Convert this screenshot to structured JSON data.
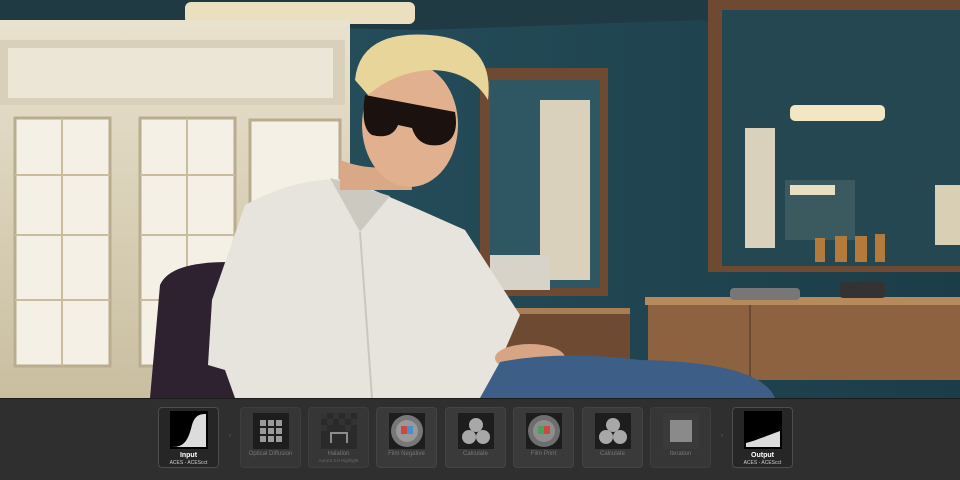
{
  "pipeline": {
    "nodes": [
      {
        "title": "Input",
        "subtitle": "ACES - ACEScct",
        "icon": "s-curve-icon"
      },
      {
        "title": "Optical Diffusion",
        "subtitle": "",
        "icon": "grid-icon"
      },
      {
        "title": "Halation",
        "subtitle": "Aurora 3.0 Highlight",
        "icon": "halation-icon"
      },
      {
        "title": "Film Negative",
        "subtitle": "",
        "icon": "film-disc-icon"
      },
      {
        "title": "Calculate",
        "subtitle": "",
        "icon": "three-circles-icon"
      },
      {
        "title": "Film Print",
        "subtitle": "",
        "icon": "film-disc-icon"
      },
      {
        "title": "Calculate",
        "subtitle": "",
        "icon": "three-circles-icon"
      },
      {
        "title": "Iteration",
        "subtitle": "",
        "icon": "square-icon"
      },
      {
        "title": "Output",
        "subtitle": "ACES - ACEScct",
        "icon": "output-curve-icon"
      }
    ],
    "connectors": [
      "›",
      "›"
    ]
  }
}
